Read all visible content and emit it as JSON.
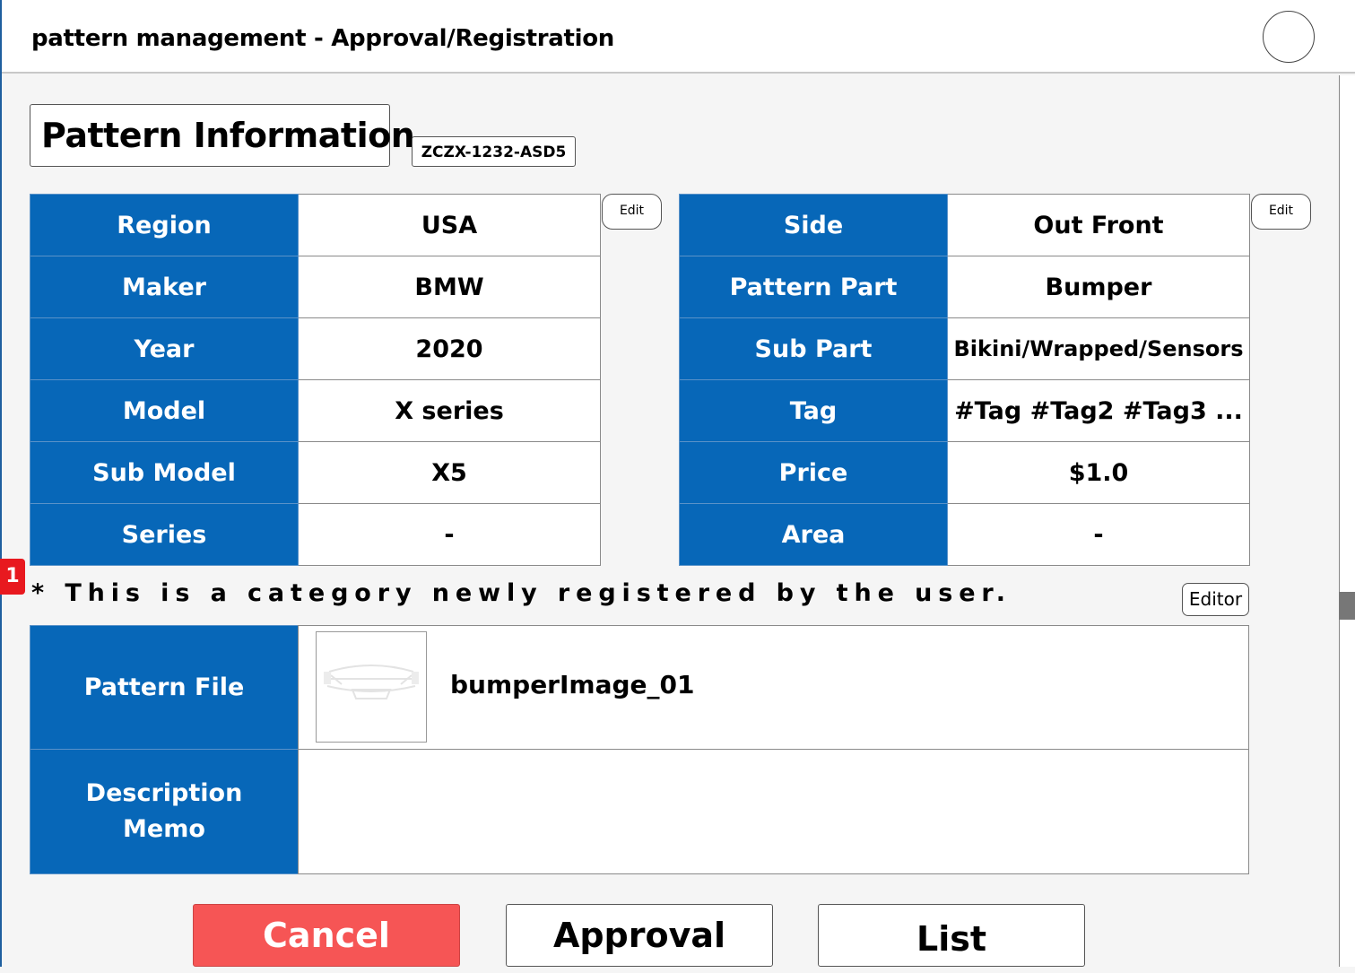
{
  "header": {
    "title": "pattern management - Approval/Registration"
  },
  "section": {
    "title": "Pattern Information",
    "code": "ZCZX-1232-ASD5"
  },
  "left_table": {
    "edit_label": "Edit",
    "rows": [
      {
        "label": "Region",
        "value": "USA"
      },
      {
        "label": "Maker",
        "value": "BMW"
      },
      {
        "label": "Year",
        "value": "2020"
      },
      {
        "label": "Model",
        "value": "X series"
      },
      {
        "label": "Sub Model",
        "value": "X5"
      },
      {
        "label": "Series",
        "value": "-"
      }
    ]
  },
  "right_table": {
    "edit_label": "Edit",
    "rows": [
      {
        "label": "Side",
        "value": "Out Front"
      },
      {
        "label": "Pattern Part",
        "value": "Bumper"
      },
      {
        "label": "Sub Part",
        "value": "Bikini/Wrapped/Sensors"
      },
      {
        "label": "Tag",
        "value": "#Tag #Tag2 #Tag3 ..."
      },
      {
        "label": "Price",
        "value": "$1.0"
      },
      {
        "label": "Area",
        "value": "-"
      }
    ]
  },
  "notice": {
    "badge": "1",
    "text": "* This is a category newly registered by the user.",
    "editor_label": "Editor"
  },
  "file": {
    "label": "Pattern File",
    "name": "bumperImage_01"
  },
  "memo": {
    "label_line1": "Description",
    "label_line2": "Memo",
    "value": ""
  },
  "actions": {
    "cancel": "Cancel",
    "approval": "Approval",
    "list": "List"
  },
  "colors": {
    "label_bg": "#0767b8",
    "cancel_bg": "#f65555",
    "badge_bg": "#e8191f"
  },
  "icons": {
    "avatar": "user-avatar-circle",
    "thumbnail": "bumper-image-thumbnail"
  }
}
